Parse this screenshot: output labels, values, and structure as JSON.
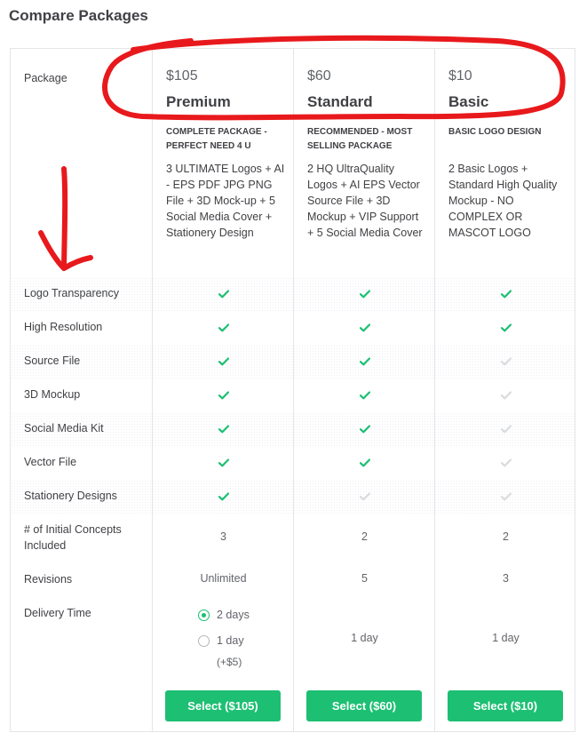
{
  "title": "Compare Packages",
  "row_labels": {
    "package": "Package",
    "features": [
      "Logo Transparency",
      "High Resolution",
      "Source File",
      "3D Mockup",
      "Social Media Kit",
      "Vector File",
      "Stationery Designs"
    ],
    "concepts": "# of Initial Concepts Included",
    "revisions": "Revisions",
    "delivery": "Delivery Time"
  },
  "packages": [
    {
      "price": "$105",
      "name": "Premium",
      "tagline": "COMPLETE PACKAGE - PERFECT NEED 4 U",
      "description": "3 ULTIMATE Logos + AI - EPS PDF JPG PNG File + 3D Mock-up + 5 Social Media Cover + Stationery Design",
      "features": [
        true,
        true,
        true,
        true,
        true,
        true,
        true
      ],
      "concepts": "3",
      "revisions": "Unlimited",
      "delivery": null,
      "button": "Select ($105)"
    },
    {
      "price": "$60",
      "name": "Standard",
      "tagline": "RECOMMENDED - MOST SELLING PACKAGE",
      "description": "2 HQ UltraQuality Logos + AI EPS Vector Source File + 3D Mockup + VIP Support + 5 Social Media Cover",
      "features": [
        true,
        true,
        true,
        true,
        true,
        true,
        false
      ],
      "concepts": "2",
      "revisions": "5",
      "delivery": "1 day",
      "button": "Select ($60)"
    },
    {
      "price": "$10",
      "name": "Basic",
      "tagline": "BASIC LOGO DESIGN",
      "description": "2 Basic Logos + Standard High Quality Mockup - NO COMPLEX OR MASCOT LOGO",
      "features": [
        true,
        true,
        false,
        false,
        false,
        false,
        false
      ],
      "concepts": "2",
      "revisions": "3",
      "delivery": "1 day",
      "button": "Select ($10)"
    }
  ],
  "premium_delivery": {
    "options": [
      {
        "label": "2 days",
        "selected": true
      },
      {
        "label": "1 day",
        "selected": false,
        "note": "(+$5)"
      }
    ]
  },
  "colors": {
    "accent": "#1dbf73",
    "check_inactive": "#dadbdd",
    "annotation": "#e8191c"
  }
}
